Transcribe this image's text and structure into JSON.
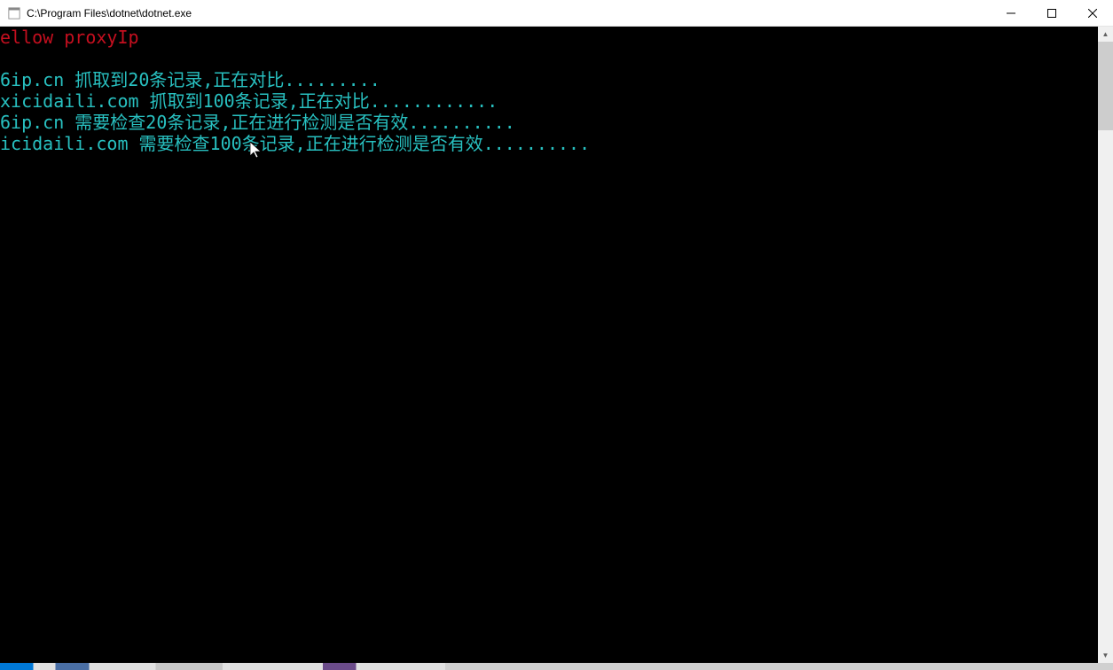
{
  "window": {
    "title": "C:\\Program Files\\dotnet\\dotnet.exe"
  },
  "console": {
    "lines": [
      {
        "text": "ellow proxyIp",
        "color": "red"
      },
      {
        "text": "",
        "color": "teal"
      },
      {
        "text": "6ip.cn 抓取到20条记录,正在对比.........",
        "color": "teal"
      },
      {
        "text": "xicidaili.com 抓取到100条记录,正在对比............",
        "color": "teal"
      },
      {
        "text": "6ip.cn 需要检查20条记录,正在进行检测是否有效..........",
        "color": "teal"
      },
      {
        "text": "icidaili.com 需要检查100条记录,正在进行检测是否有效..........",
        "color": "teal"
      }
    ]
  }
}
